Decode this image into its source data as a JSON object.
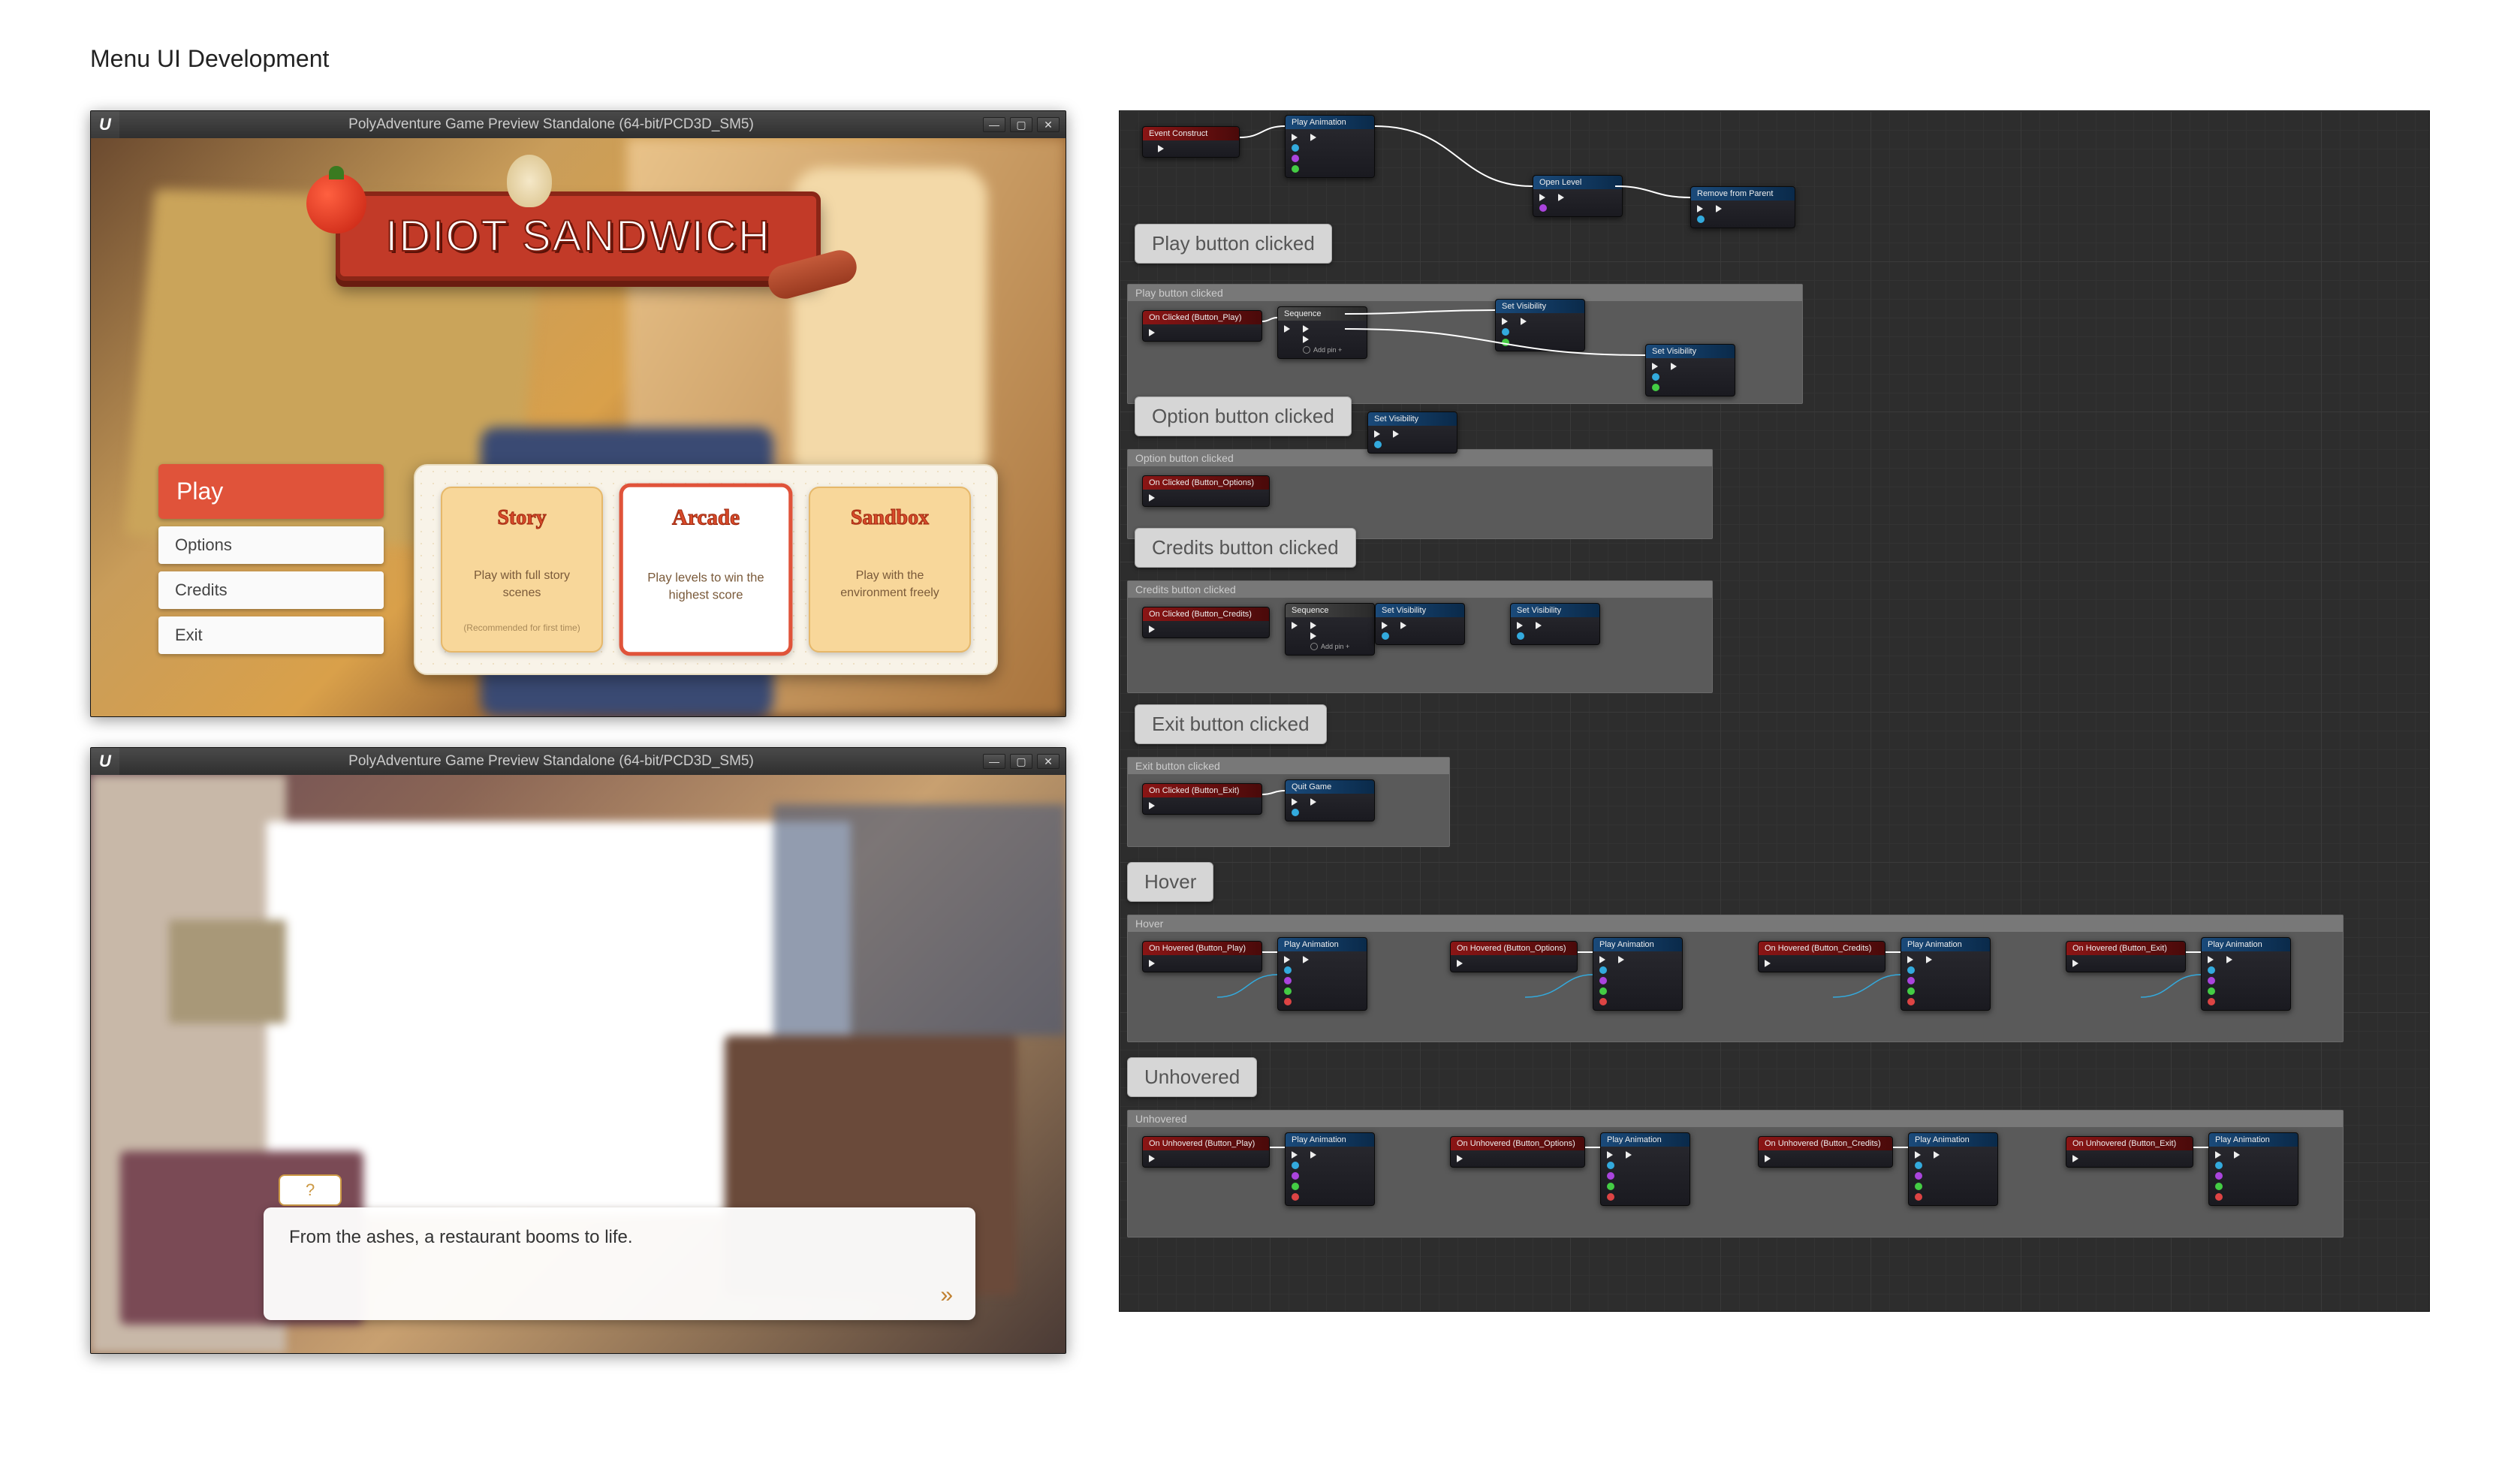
{
  "page": {
    "title": "Menu UI Development"
  },
  "window": {
    "title": "PolyAdventure Game Preview Standalone (64-bit/PCD3D_SM5)",
    "logo": "U",
    "min": "—",
    "max": "▢",
    "close": "✕"
  },
  "logo": {
    "text": "IDIOT SANDWICH"
  },
  "menu": {
    "play": "Play",
    "options": "Options",
    "credits": "Credits",
    "exit": "Exit"
  },
  "modes": {
    "story": {
      "title": "Story",
      "desc": "Play with full story scenes",
      "note": "(Recommended for first time)"
    },
    "arcade": {
      "title": "Arcade",
      "desc": "Play levels to win the highest score"
    },
    "sandbox": {
      "title": "Sandbox",
      "desc": "Play with the environment freely"
    }
  },
  "vn": {
    "speaker": "?",
    "line": "From the ashes, a restaurant booms to life.",
    "advance": "»"
  },
  "bp": {
    "tags": {
      "play": "Play button clicked",
      "option": "Option button clicked",
      "credits": "Credits button clicked",
      "exit": "Exit button clicked",
      "hover": "Hover",
      "unhover": "Unhovered"
    },
    "comments": {
      "play": "Play button clicked",
      "option": "Option button clicked",
      "credits": "Credits button clicked",
      "exit": "Exit button clicked",
      "hover": "Hover",
      "unhover": "Unhovered"
    },
    "nodes": {
      "construct": "Event Construct",
      "playanim": "Play Animation",
      "openlevel": "Open Level",
      "removeparent": "Remove from Parent",
      "seq": "Sequence",
      "setvis": "Set Visibility",
      "quit": "Quit Game",
      "click_play": "On Clicked (Button_Play)",
      "click_opt": "On Clicked (Button_Options)",
      "click_cred": "On Clicked (Button_Credits)",
      "click_exit": "On Clicked (Button_Exit)",
      "hov_play": "On Hovered (Button_Play)",
      "hov_opt": "On Hovered (Button_Options)",
      "hov_cred": "On Hovered (Button_Credits)",
      "hov_exit": "On Hovered (Button_Exit)",
      "unhov_play": "On Unhovered (Button_Play)",
      "unhov_opt": "On Unhovered (Button_Options)",
      "unhov_cred": "On Unhovered (Button_Credits)",
      "unhov_exit": "On Unhovered (Button_Exit)",
      "addpin": "Add pin +"
    }
  }
}
